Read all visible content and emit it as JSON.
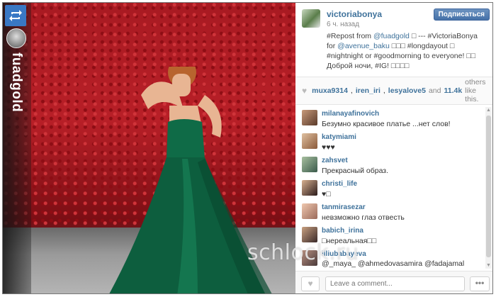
{
  "photo": {
    "poster_username": "fuadgold",
    "repost_icon": "repost-icon"
  },
  "post": {
    "author": "victoriabonya",
    "time": "6 ч. назад",
    "follow_label": "Подписаться",
    "caption": {
      "p1": "#Repost from ",
      "mention1": "@fuadgold",
      "p2": " □ --- #VictoriaBonya for ",
      "mention2": "@avenue_baku",
      "p3": " □□□ #longdayout □ #nightnight or #goodmorning to everyone! □□ Доброй ночи, #IG! □□□□"
    }
  },
  "likes": {
    "users": [
      "muxa9314",
      "iren_iri",
      "lesyalove5"
    ],
    "and": "and",
    "count": "11.4k",
    "rest": "others like this."
  },
  "comments": [
    {
      "user": "milanayafinovich",
      "text": "Безумно красивое платье ...нет слов!"
    },
    {
      "user": "katymiami",
      "text": "♥♥♥"
    },
    {
      "user": "zahsvet",
      "text": "Прекрасный образ."
    },
    {
      "user": "christi_life",
      "text": "♥□"
    },
    {
      "user": "tanmirasezar",
      "text": "невзможно глаз отвесть"
    },
    {
      "user": "babich_irina",
      "text": "□нереальная□□"
    },
    {
      "user": "liliubabayeva",
      "text": "@_maya_ @ahmedovasamira @fadajamal Aydan paltarivu prokata vermisen?:D"
    }
  ],
  "footer": {
    "comment_placeholder": "Leave a comment...",
    "more_label": "•••"
  },
  "watermark": "schlock.ru"
}
